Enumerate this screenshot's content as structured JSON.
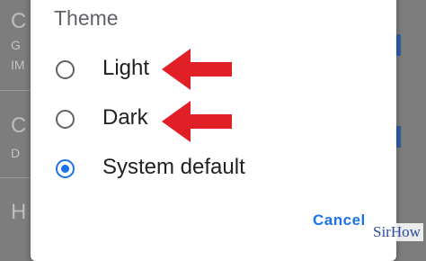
{
  "background": {
    "rows": [
      {
        "title": "C",
        "subtitle": "G",
        "meta": "IM"
      },
      {
        "title": "C",
        "subtitle": "D"
      },
      {
        "title": "H"
      }
    ]
  },
  "dialog": {
    "title": "Theme",
    "options": [
      {
        "label": "Light",
        "selected": false
      },
      {
        "label": "Dark",
        "selected": false
      },
      {
        "label": "System default",
        "selected": true
      }
    ],
    "cancel_label": "Cancel"
  },
  "watermark": "SirHow",
  "colors": {
    "accent": "#1a73e8",
    "arrow": "#e11f26",
    "radio_off": "#616161",
    "scrim": "#7d7d7d"
  }
}
